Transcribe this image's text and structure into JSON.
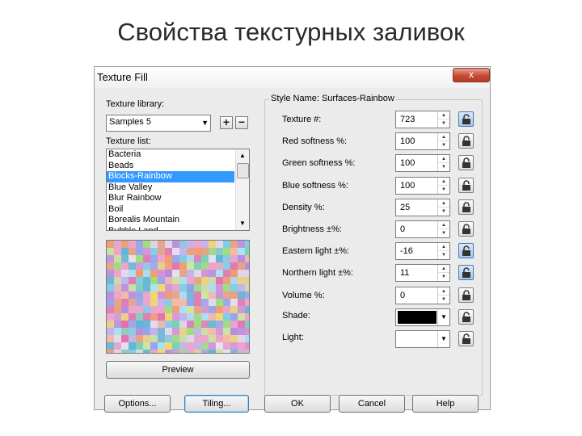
{
  "slide": {
    "title": "Свойства текстурных заливок"
  },
  "window": {
    "title": "Texture Fill",
    "close_glyph": "x"
  },
  "left": {
    "library_label": "Texture library:",
    "library_value": "Samples 5",
    "add_glyph": "+",
    "remove_glyph": "−",
    "list_label": "Texture list:",
    "list_items": [
      "Bacteria",
      "Beads",
      "Blocks-Rainbow",
      "Blue Valley",
      "Blur Rainbow",
      "Boil",
      "Borealis Mountain",
      "Bubble Land"
    ],
    "selected_item": "Blocks-Rainbow",
    "preview_button": "Preview"
  },
  "style": {
    "style_name_label": "Style Name: Surfaces-Rainbow",
    "params": [
      {
        "label": "Texture #:",
        "value": "723",
        "locked": true
      },
      {
        "label": "Red softness %:",
        "value": "100",
        "locked": false
      },
      {
        "label": "Green softness %:",
        "value": "100",
        "locked": false
      },
      {
        "label": "Blue softness %:",
        "value": "100",
        "locked": false
      },
      {
        "label": "Density %:",
        "value": "25",
        "locked": false
      },
      {
        "label": "Brightness ±%:",
        "value": "0",
        "locked": false
      },
      {
        "label": "Eastern light ±%:",
        "value": "-16",
        "locked": true
      },
      {
        "label": "Northern light ±%:",
        "value": "11",
        "locked": true
      },
      {
        "label": "Volume %:",
        "value": "0",
        "locked": false
      }
    ],
    "shade": {
      "label": "Shade:",
      "color": "#000000",
      "locked": false
    },
    "light": {
      "label": "Light:",
      "color": "#ffffff",
      "locked": false
    }
  },
  "buttons": {
    "options": "Options...",
    "tiling": "Tiling...",
    "ok": "OK",
    "cancel": "Cancel",
    "help": "Help"
  },
  "icons": {
    "close": "close-icon",
    "lock": "lock-icon",
    "dropdown": "chevron-down-icon"
  }
}
